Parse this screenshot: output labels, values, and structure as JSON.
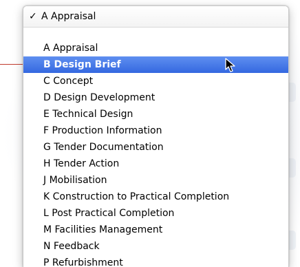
{
  "dropdown": {
    "selected_label": "A Appraisal",
    "check_glyph": "✓",
    "highlighted_index": 1,
    "items": [
      "A Appraisal",
      "B Design Brief",
      "C Concept",
      "D Design Development",
      "E Technical Design",
      "F Production Information",
      "G Tender Documentation",
      "H Tender Action",
      "J Mobilisation",
      "K Construction to Practical Completion",
      "L Post Practical Completion",
      "M Facilities Management",
      "N Feedback",
      "P Refurbishment"
    ],
    "highlight_color": "#3d72e6",
    "callout_color": "#c0392b"
  }
}
